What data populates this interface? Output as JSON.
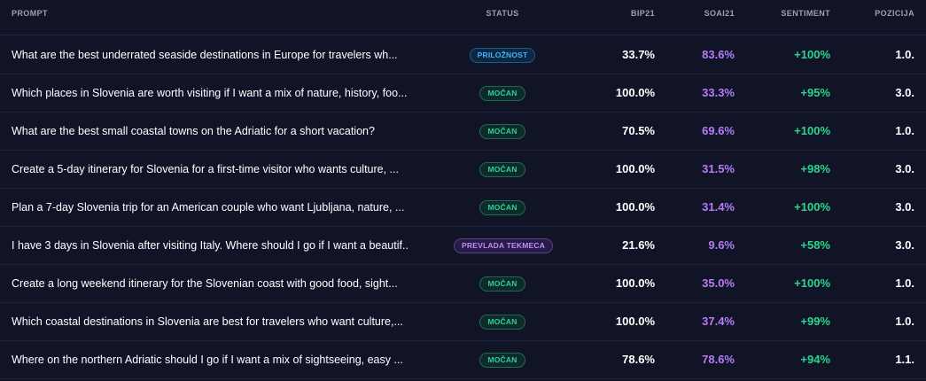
{
  "header": {
    "prompt": "PROMPT",
    "status": "STATUS",
    "bip": "BIP21",
    "soai": "SOAI21",
    "sentiment": "SENTIMENT",
    "pozicija": "POZICIJA"
  },
  "colors": {
    "background": "#111427",
    "status_mocan": "#2bd394",
    "status_priloznost": "#36b6ff",
    "status_prevlada": "#c58bff",
    "soai_text": "#b57cf5",
    "sentiment_text": "#2cd58f"
  },
  "rows": [
    {
      "prompt": "What are the best underrated seaside destinations in Europe for travelers wh...",
      "status": "PRILOŽNOST",
      "status_type": "blue",
      "bip": "33.7%",
      "soai": "83.6%",
      "sentiment": "+100%",
      "pozicija": "1.0."
    },
    {
      "prompt": "Which places in Slovenia are worth visiting if I want a mix of nature, history, foo...",
      "status": "MOČAN",
      "status_type": "green",
      "bip": "100.0%",
      "soai": "33.3%",
      "sentiment": "+95%",
      "pozicija": "3.0."
    },
    {
      "prompt": "What are the best small coastal towns on the Adriatic for a short vacation?",
      "status": "MOČAN",
      "status_type": "green",
      "bip": "70.5%",
      "soai": "69.6%",
      "sentiment": "+100%",
      "pozicija": "1.0."
    },
    {
      "prompt": "Create a 5-day itinerary for Slovenia for a first-time visitor who wants culture, ...",
      "status": "MOČAN",
      "status_type": "green",
      "bip": "100.0%",
      "soai": "31.5%",
      "sentiment": "+98%",
      "pozicija": "3.0."
    },
    {
      "prompt": "Plan a 7-day Slovenia trip for an American couple who want Ljubljana, nature, ...",
      "status": "MOČAN",
      "status_type": "green",
      "bip": "100.0%",
      "soai": "31.4%",
      "sentiment": "+100%",
      "pozicija": "3.0."
    },
    {
      "prompt": "I have 3 days in Slovenia after visiting Italy. Where should I go if I want a beautif...",
      "status": "PREVLADA TEKMECA",
      "status_type": "purple",
      "bip": "21.6%",
      "soai": "9.6%",
      "sentiment": "+58%",
      "pozicija": "3.0."
    },
    {
      "prompt": "Create a long weekend itinerary for the Slovenian coast with good food, sight...",
      "status": "MOČAN",
      "status_type": "green",
      "bip": "100.0%",
      "soai": "35.0%",
      "sentiment": "+100%",
      "pozicija": "1.0."
    },
    {
      "prompt": "Which coastal destinations in Slovenia are best for travelers who want culture,...",
      "status": "MOČAN",
      "status_type": "green",
      "bip": "100.0%",
      "soai": "37.4%",
      "sentiment": "+99%",
      "pozicija": "1.0."
    },
    {
      "prompt": "Where on the northern Adriatic should I go if I want a mix of sightseeing, easy ...",
      "status": "MOČAN",
      "status_type": "green",
      "bip": "78.6%",
      "soai": "78.6%",
      "sentiment": "+94%",
      "pozicija": "1.1."
    }
  ]
}
